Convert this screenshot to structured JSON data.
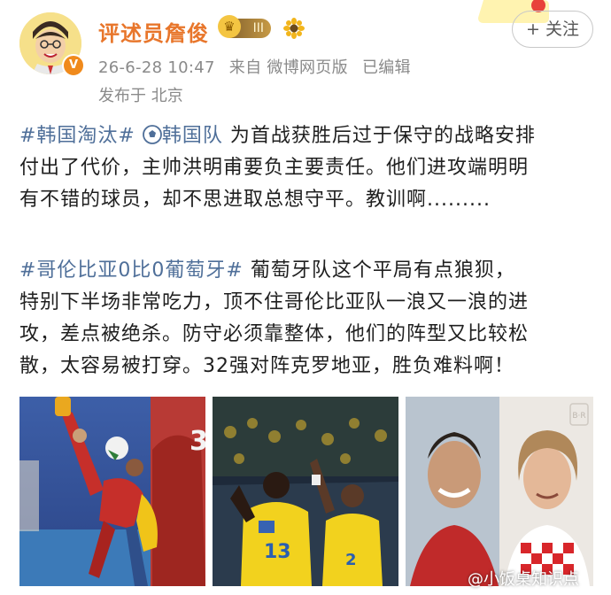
{
  "post": {
    "username": "评述员詹俊",
    "vip_level": "III",
    "date": "26-6-28 10:47",
    "source": "来自 微博网页版",
    "edited": "已编辑",
    "location": "发布于 北京",
    "follow_label": "+ 关注"
  },
  "paragraph1": {
    "tag1": "#韩国淘汰#",
    "tag2": "韩国队",
    "line1_rest": " 为首战获胜后过于保守的战略安排",
    "line2": "付出了代价，主帅洪明甫要负主要责任。他们进攻端明明",
    "line3": "有不错的球员，却不思进取总想守平。教训啊........."
  },
  "paragraph2": {
    "tag": "#哥伦比亚0比0葡萄牙#",
    "line1_rest": " 葡萄牙队这个平局有点狼狈，",
    "line2": "特别下半场非常吃力，顶不住哥伦比亚队一浪又一浪的进",
    "line3": "攻，差点被绝杀。防守必须靠整体，他们的阵型又比较松",
    "line4": "散，太容易被打穿。32强对阵克罗地亚，胜负难料啊！"
  },
  "images": {
    "watermark": "@小饭桌知识点",
    "photo3_logo": "B·R",
    "jersey_number_left": "3"
  },
  "icons": {
    "avatar": "cartoon-avatar",
    "verified": "verified-badge-icon",
    "vip": "crown-icon",
    "flower": "sunflower-icon",
    "football": "football-icon"
  },
  "colors": {
    "username": "#e8762b",
    "tag": "#4f6f99",
    "meta": "#8a8a8a"
  }
}
